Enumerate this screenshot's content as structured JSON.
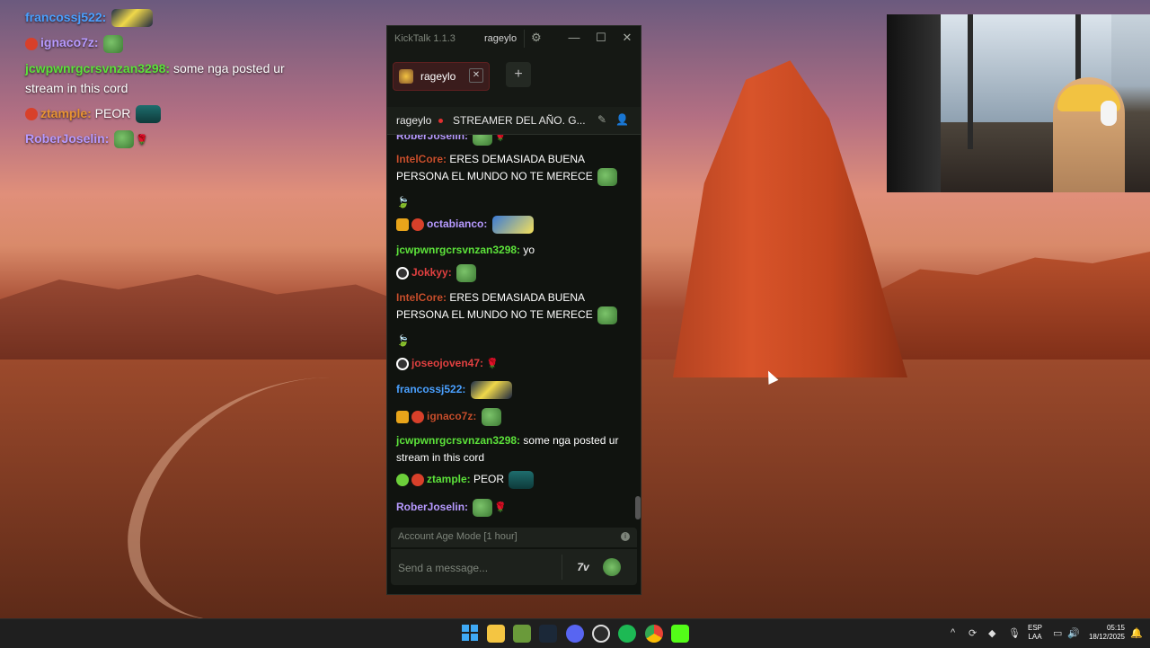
{
  "overlay": {
    "messages": [
      {
        "user": "francossj522:",
        "text": ""
      },
      {
        "user": "ignaco7z:",
        "text": ""
      },
      {
        "user": "jcwpwnrgcrsvnzan3298:",
        "text": " some nga posted ur stream in this cord"
      },
      {
        "user": "ztample:",
        "text": " PEOR"
      },
      {
        "user": "RoberJoselin:",
        "text": ""
      }
    ]
  },
  "window": {
    "app_name": "KickTalk 1.1.3",
    "user": "rageylo",
    "gear_icon": "⚙",
    "minimize_icon": "—",
    "maximize_icon": "☐",
    "close_icon": "✕"
  },
  "tabs": {
    "items": [
      {
        "label": "rageylo",
        "close": "✕"
      }
    ],
    "add_label": "+"
  },
  "chat_header": {
    "channel": "rageylo",
    "title": "STREAMER DEL AÑO. G...",
    "pin_icon": "✎",
    "user_icon": "👤"
  },
  "chat": {
    "messages": [
      {
        "user": "RoberJoselin:",
        "text": ""
      },
      {
        "user": "IntelCore:",
        "text": " ERES DEMASIADA BUENA PERSONA EL MUNDO NO TE MERECE"
      },
      {
        "user": "",
        "text": "🍃"
      },
      {
        "user": "octabianco:",
        "text": ""
      },
      {
        "user": "jcwpwnrgcrsvnzan3298:",
        "text": " yo"
      },
      {
        "user": "Jokkyy:",
        "text": ""
      },
      {
        "user": "IntelCore:",
        "text": " ERES DEMASIADA BUENA PERSONA EL MUNDO NO TE MERECE"
      },
      {
        "user": "",
        "text": "🍃"
      },
      {
        "user": "joseojoven47:",
        "text": ""
      },
      {
        "user": "francossj522:",
        "text": ""
      },
      {
        "user": "ignaco7z:",
        "text": ""
      },
      {
        "user": "jcwpwnrgcrsvnzan3298:",
        "text": " some nga posted ur stream in this cord"
      },
      {
        "user": "ztample:",
        "text": " PEOR"
      },
      {
        "user": "RoberJoselin:",
        "text": ""
      }
    ]
  },
  "composer": {
    "mode_label": "Account Age Mode [1 hour]",
    "mode_icon": "i",
    "placeholder": "Send a message...",
    "seventv_label": "7v"
  },
  "taskbar": {
    "apps": [
      "windows-start",
      "file-explorer",
      "minecraft",
      "steam",
      "discord",
      "obs",
      "spotify",
      "chrome",
      "kick"
    ],
    "tray": {
      "chevron": "^",
      "lang_top": "ESP",
      "lang_bottom": "LAA",
      "time": "05:15",
      "date": "18/12/2025"
    }
  },
  "colors": {
    "kick_green": "#53fc18",
    "window_bg": "#10130f",
    "tab_bg": "#3a1c1c"
  }
}
